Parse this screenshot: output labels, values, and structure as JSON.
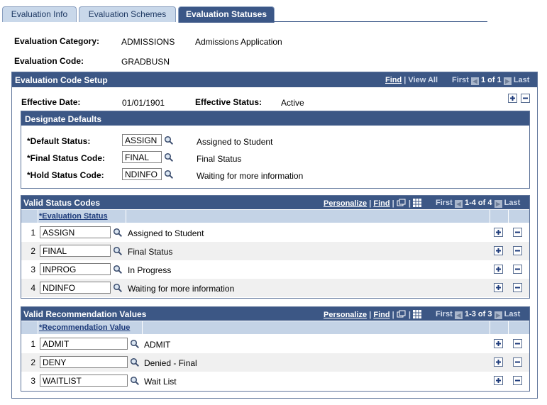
{
  "tabs": [
    {
      "label": "Evaluation Info",
      "active": false
    },
    {
      "label": "Evaluation Schemes",
      "active": false
    },
    {
      "label": "Evaluation Statuses",
      "active": true
    }
  ],
  "header": {
    "category_label": "Evaluation Category:",
    "category_value": "ADMISSIONS",
    "category_desc": "Admissions Application",
    "code_label": "Evaluation Code:",
    "code_value": "GRADBUSN"
  },
  "setup": {
    "title": "Evaluation Code Setup",
    "nav": {
      "find": "Find",
      "view_all": "View All",
      "first": "First",
      "range": "1 of 1",
      "last": "Last"
    },
    "effective_date_label": "Effective Date:",
    "effective_date_value": "01/01/1901",
    "effective_status_label": "Effective Status:",
    "effective_status_value": "Active"
  },
  "defaults": {
    "title": "Designate Defaults",
    "fields": [
      {
        "label": "*Default Status:",
        "value": "ASSIGN",
        "desc": "Assigned to Student"
      },
      {
        "label": "*Final Status Code:",
        "value": "FINAL",
        "desc": "Final Status"
      },
      {
        "label": "*Hold Status Code:",
        "value": "NDINFO",
        "desc": "Waiting for more information"
      }
    ]
  },
  "status_codes": {
    "title": "Valid Status Codes",
    "nav": {
      "personalize": "Personalize",
      "find": "Find",
      "first": "First",
      "range": "1-4 of 4",
      "last": "Last"
    },
    "column": "*Evaluation Status",
    "rows": [
      {
        "num": "1",
        "value": "ASSIGN",
        "desc": "Assigned to Student"
      },
      {
        "num": "2",
        "value": "FINAL",
        "desc": "Final Status"
      },
      {
        "num": "3",
        "value": "INPROG",
        "desc": "In Progress"
      },
      {
        "num": "4",
        "value": "NDINFO",
        "desc": "Waiting for more information"
      }
    ]
  },
  "recommendations": {
    "title": "Valid Recommendation Values",
    "nav": {
      "personalize": "Personalize",
      "find": "Find",
      "first": "First",
      "range": "1-3 of 3",
      "last": "Last"
    },
    "column": "*Recommendation Value",
    "rows": [
      {
        "num": "1",
        "value": "ADMIT",
        "desc": "ADMIT"
      },
      {
        "num": "2",
        "value": "DENY",
        "desc": "Denied - Final"
      },
      {
        "num": "3",
        "value": "WAITLIST",
        "desc": "Wait List"
      }
    ]
  },
  "icons": {
    "lookup": "magnifier-icon",
    "add": "plus-icon",
    "remove": "minus-icon",
    "view": "view-icon",
    "grid": "grid-icon"
  }
}
